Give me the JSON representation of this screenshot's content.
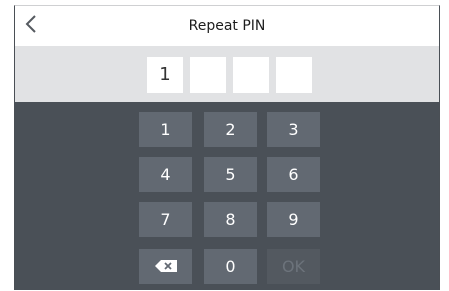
{
  "header": {
    "title": "Repeat PIN",
    "back_icon": "chevron-left-icon"
  },
  "pin": {
    "digits": [
      "1",
      "",
      "",
      ""
    ]
  },
  "keypad": {
    "keys": [
      "1",
      "2",
      "3",
      "4",
      "5",
      "6",
      "7",
      "8",
      "9"
    ],
    "zero": "0",
    "ok": "OK",
    "ok_enabled": false,
    "backspace_icon": "backspace-icon"
  },
  "colors": {
    "keypad_bg": "#4a5057",
    "key_bg": "#626972",
    "pin_area_bg": "#e1e2e4"
  }
}
